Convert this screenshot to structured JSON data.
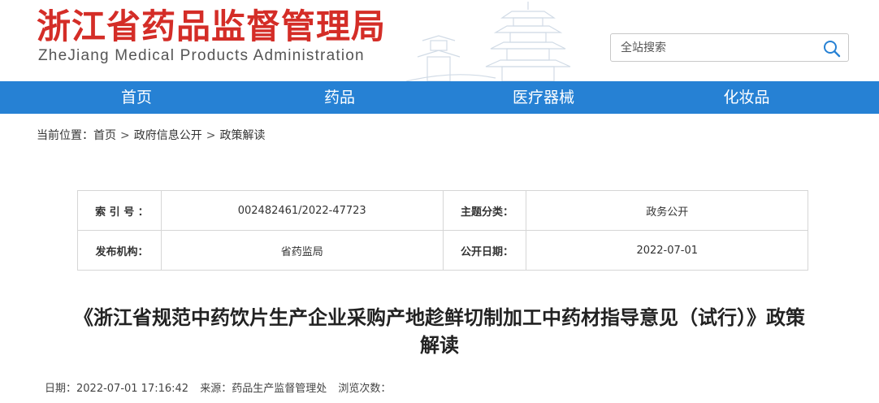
{
  "header": {
    "title_cn": "浙江省药品监督管理局",
    "title_en": "ZheJiang Medical Products Administration",
    "logo_icon": "pagoda-silhouette-icon"
  },
  "search": {
    "placeholder": "全站搜索",
    "button_icon": "search-icon"
  },
  "nav": {
    "items": [
      {
        "label": "首页"
      },
      {
        "label": "药品"
      },
      {
        "label": "医疗器械"
      },
      {
        "label": "化妆品"
      }
    ]
  },
  "breadcrumb": {
    "prefix": "当前位置：",
    "items": [
      "首页",
      "政府信息公开",
      "政策解读"
    ],
    "separator": ">"
  },
  "info": {
    "index_label": "索 引 号 ：",
    "index_value": "002482461/2022-47723",
    "topic_label": "主题分类：",
    "topic_value": "政务公开",
    "publisher_label": "发布机构：",
    "publisher_value": "省药监局",
    "date_label": "公开日期：",
    "date_value": "2022-07-01"
  },
  "article": {
    "title": "《浙江省规范中药饮片生产企业采购产地趁鲜切制加工中药材指导意见（试行）》政策解读",
    "date": "日期：2022-07-01 17:16:42",
    "source": "来源：药品生产监督管理处",
    "views": "浏览次数："
  },
  "colors": {
    "title_red": "#d42d27",
    "nav_blue": "#2681d4"
  }
}
